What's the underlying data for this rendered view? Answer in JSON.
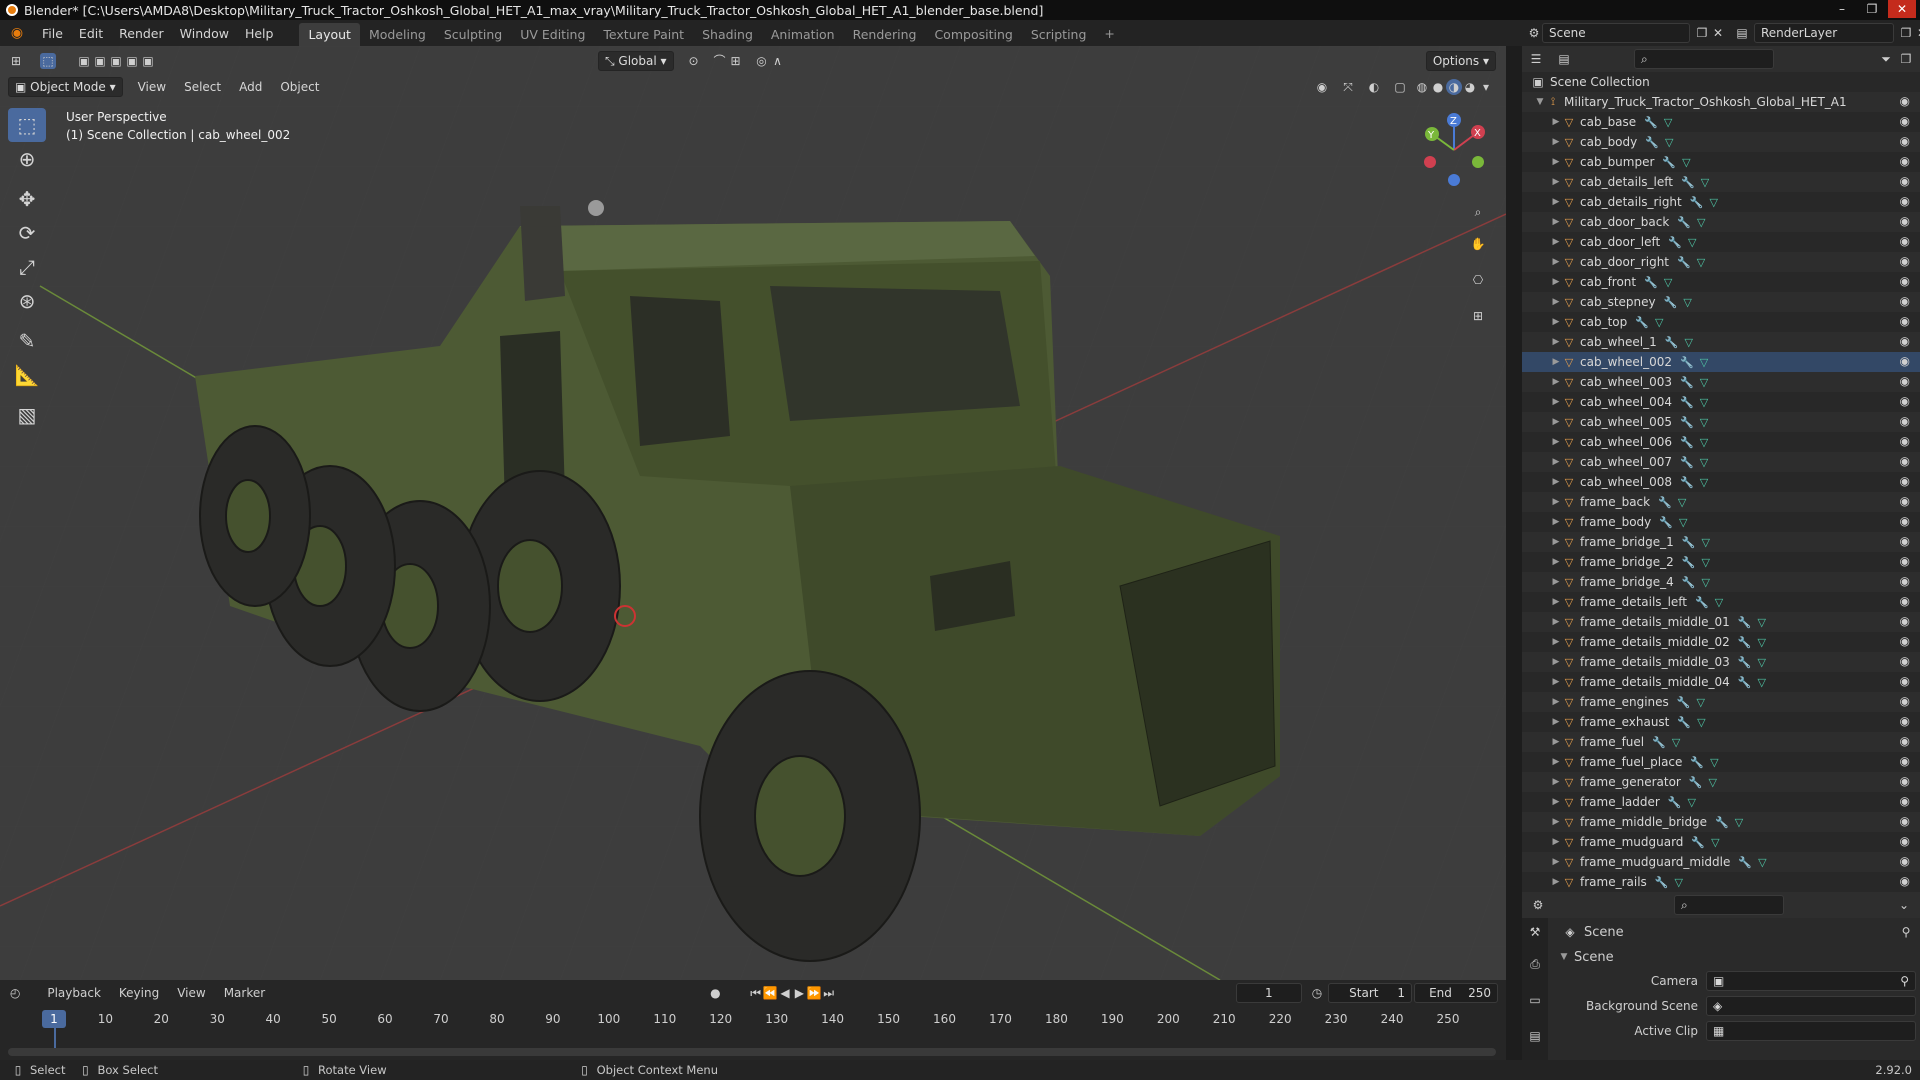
{
  "window": {
    "title": "Blender* [C:\\Users\\AMDA8\\Desktop\\Military_Truck_Tractor_Oshkosh_Global_HET_A1_max_vray\\Military_Truck_Tractor_Oshkosh_Global_HET_A1_blender_base.blend]",
    "min": "–",
    "max": "❐",
    "close": "✕"
  },
  "menu": [
    "File",
    "Edit",
    "Render",
    "Window",
    "Help"
  ],
  "workspaces": [
    "Layout",
    "Modeling",
    "Sculpting",
    "UV Editing",
    "Texture Paint",
    "Shading",
    "Animation",
    "Rendering",
    "Compositing",
    "Scripting"
  ],
  "workspace_add": "+",
  "scene": {
    "label": "Scene",
    "layer": "RenderLayer"
  },
  "viewport": {
    "transform_orientation": "Global",
    "options": "Options",
    "mode": "Object Mode",
    "menus": [
      "View",
      "Select",
      "Add",
      "Object"
    ],
    "overlay_line1": "User Perspective",
    "overlay_line2": "(1) Scene Collection | cab_wheel_002",
    "gizmo": {
      "x": "X",
      "y": "Y",
      "z": "Z"
    }
  },
  "outliner": {
    "root": "Scene Collection",
    "collection": "Military_Truck_Tractor_Oshkosh_Global_HET_A1",
    "items": [
      "cab_base",
      "cab_body",
      "cab_bumper",
      "cab_details_left",
      "cab_details_right",
      "cab_door_back",
      "cab_door_left",
      "cab_door_right",
      "cab_front",
      "cab_stepney",
      "cab_top",
      "cab_wheel_1",
      "cab_wheel_002",
      "cab_wheel_003",
      "cab_wheel_004",
      "cab_wheel_005",
      "cab_wheel_006",
      "cab_wheel_007",
      "cab_wheel_008",
      "frame_back",
      "frame_body",
      "frame_bridge_1",
      "frame_bridge_2",
      "frame_bridge_4",
      "frame_details_left",
      "frame_details_middle_01",
      "frame_details_middle_02",
      "frame_details_middle_03",
      "frame_details_middle_04",
      "frame_engines",
      "frame_exhaust",
      "frame_fuel",
      "frame_fuel_place",
      "frame_generator",
      "frame_ladder",
      "frame_middle_bridge",
      "frame_mudguard",
      "frame_mudguard_middle",
      "frame_rails"
    ]
  },
  "properties": {
    "header": "Scene",
    "panel": "Scene",
    "camera_label": "Camera",
    "background_label": "Background Scene",
    "clip_label": "Active Clip"
  },
  "timeline": {
    "menus": [
      "Playback",
      "Keying",
      "View",
      "Marker"
    ],
    "current_frame": "1",
    "start_label": "Start",
    "start": "1",
    "end_label": "End",
    "end": "250",
    "ticks": [
      "1",
      "10",
      "20",
      "30",
      "40",
      "50",
      "60",
      "70",
      "80",
      "90",
      "100",
      "110",
      "120",
      "130",
      "140",
      "150",
      "160",
      "170",
      "180",
      "190",
      "200",
      "210",
      "220",
      "230",
      "240",
      "250"
    ]
  },
  "status": {
    "select": "Select",
    "box_select": "Box Select",
    "rotate": "Rotate View",
    "context_menu": "Object Context Menu",
    "version": "2.92.0"
  },
  "colors": {
    "accent": "#4a6a9e",
    "selected": "#3a5078",
    "truck": "#4d5a34",
    "orange": "#e8a04d"
  }
}
